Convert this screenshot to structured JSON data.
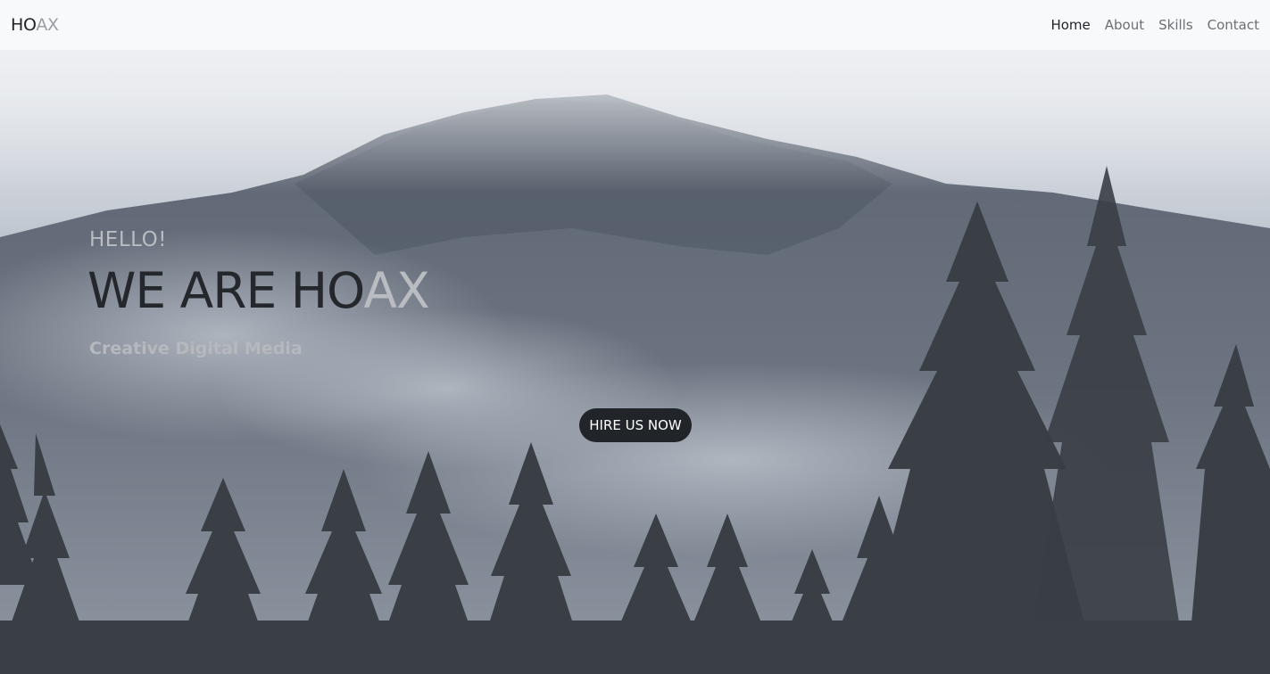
{
  "navbar": {
    "brand_dark": "HO",
    "brand_light": "AX",
    "links": [
      {
        "label": "Home",
        "active": true
      },
      {
        "label": "About",
        "active": false
      },
      {
        "label": "Skills",
        "active": false
      },
      {
        "label": "Contact",
        "active": false
      }
    ]
  },
  "hero": {
    "greeting": "HELLO!",
    "headline_dark": "WE ARE HO",
    "headline_light": "AX",
    "tagline": "Creative Digital Media",
    "cta_label": "HIRE US NOW"
  },
  "colors": {
    "navbar_bg": "#f8f9fa",
    "text_dark": "#212529",
    "text_muted": "#b9bcc1",
    "button_bg": "#212529",
    "button_text": "#ffffff"
  }
}
